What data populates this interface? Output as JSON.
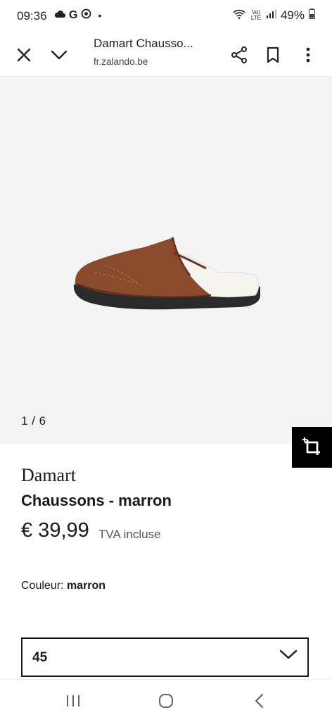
{
  "status_bar": {
    "time": "09:36",
    "left_icons": [
      "cloud-icon",
      "google-icon",
      "camera-lens-icon",
      "dot-icon"
    ],
    "left_g": "G",
    "left_dot": "•",
    "signal_label": "Vo) LTE",
    "battery_percent": "49%"
  },
  "toolbar": {
    "page_title": "Damart Chausso...",
    "url": "fr.zalando.be",
    "icons": [
      "close-icon",
      "chevron-down-icon",
      "share-icon",
      "bookmark-icon",
      "more-vert-icon"
    ]
  },
  "gallery": {
    "counter": "1 / 6",
    "background": "#f4f4f4",
    "crop_button_icon": "crop-icon"
  },
  "product": {
    "brand": "Damart",
    "name": "Chaussons - marron",
    "price": "€ 39,99",
    "tax_note": "TVA incluse",
    "color_label": "Couleur:",
    "color_value": "marron",
    "size_selected": "45"
  },
  "nav_bar": {
    "icons": [
      "recents-icon",
      "home-icon",
      "back-icon"
    ]
  }
}
